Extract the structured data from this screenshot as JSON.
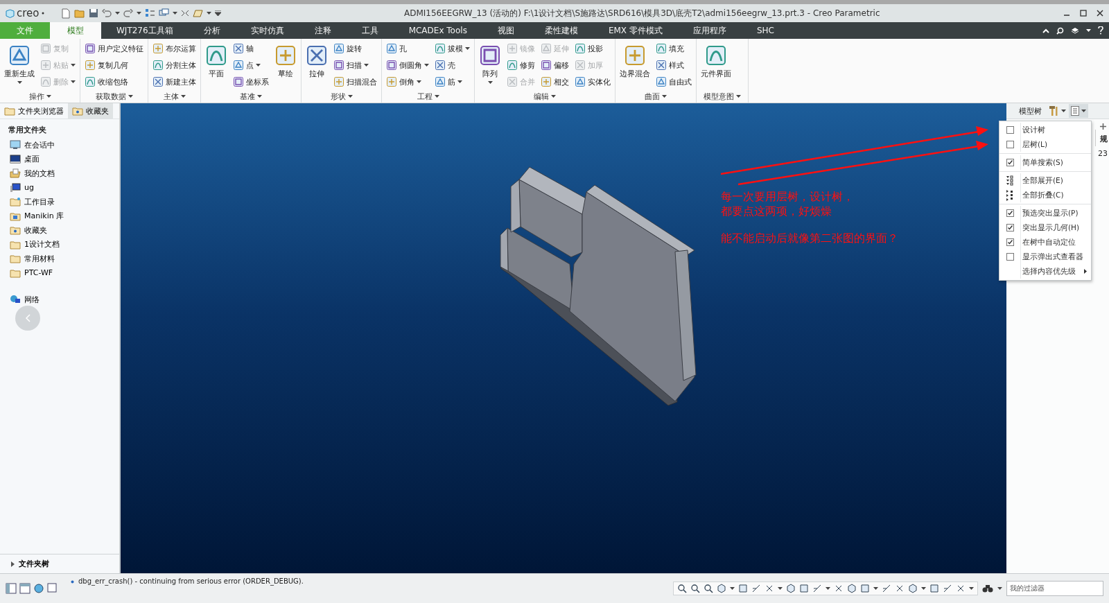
{
  "window": {
    "logo": "creo",
    "title": "ADMI156EEGRW_13 (活动的) F:\\1设计文档\\S施路达\\SRD616\\模具3D\\底壳T2\\admi156eegrw_13.prt.3 - Creo Parametric"
  },
  "tabs": [
    {
      "label": "文件",
      "kind": "file",
      "selected": false
    },
    {
      "label": "模型",
      "kind": "tab",
      "selected": true
    },
    {
      "label": "WJT276工具箱",
      "kind": "tab",
      "selected": false
    },
    {
      "label": "分析",
      "kind": "tab",
      "selected": false
    },
    {
      "label": "实时仿真",
      "kind": "tab",
      "selected": false
    },
    {
      "label": "注释",
      "kind": "tab",
      "selected": false
    },
    {
      "label": "工具",
      "kind": "tab",
      "selected": false
    },
    {
      "label": "MCADEx Tools",
      "kind": "tab",
      "selected": false
    },
    {
      "label": "视图",
      "kind": "tab",
      "selected": false
    },
    {
      "label": "柔性建模",
      "kind": "tab",
      "selected": false
    },
    {
      "label": "EMX 零件模式",
      "kind": "tab",
      "selected": false
    },
    {
      "label": "应用程序",
      "kind": "tab",
      "selected": false
    },
    {
      "label": "SHC",
      "kind": "tab",
      "selected": false
    }
  ],
  "ribbon": [
    {
      "label": "操作",
      "items": [
        {
          "kind": "large",
          "label": "重新生成",
          "menu": true,
          "disabled": false
        },
        {
          "kind": "small",
          "label": "复制",
          "menu": false,
          "disabled": true
        },
        {
          "kind": "small",
          "label": "粘贴",
          "menu": true,
          "disabled": true
        },
        {
          "kind": "small",
          "label": "删除",
          "menu": true,
          "disabled": true
        }
      ]
    },
    {
      "label": "获取数据",
      "items": [
        {
          "kind": "small",
          "label": "用户定义特征",
          "menu": false,
          "disabled": false
        },
        {
          "kind": "small",
          "label": "复制几何",
          "menu": false,
          "disabled": false
        },
        {
          "kind": "small",
          "label": "收缩包络",
          "menu": false,
          "disabled": false
        }
      ]
    },
    {
      "label": "主体",
      "items": [
        {
          "kind": "small",
          "label": "布尔运算",
          "menu": false,
          "disabled": false
        },
        {
          "kind": "small",
          "label": "分割主体",
          "menu": false,
          "disabled": false
        },
        {
          "kind": "small",
          "label": "新建主体",
          "menu": false,
          "disabled": false
        }
      ]
    },
    {
      "label": "基准",
      "items": [
        {
          "kind": "large",
          "label": "平面",
          "menu": false,
          "disabled": false
        },
        {
          "kind": "small",
          "label": "轴",
          "menu": false,
          "disabled": false
        },
        {
          "kind": "small",
          "label": "点",
          "menu": true,
          "disabled": false
        },
        {
          "kind": "small",
          "label": "坐标系",
          "menu": false,
          "disabled": false
        },
        {
          "kind": "large",
          "label": "草绘",
          "menu": false,
          "disabled": false
        }
      ]
    },
    {
      "label": "形状",
      "items": [
        {
          "kind": "large",
          "label": "拉伸",
          "menu": false,
          "disabled": false
        },
        {
          "kind": "small",
          "label": "旋转",
          "menu": false,
          "disabled": false
        },
        {
          "kind": "small",
          "label": "扫描",
          "menu": true,
          "disabled": false
        },
        {
          "kind": "small",
          "label": "扫描混合",
          "menu": false,
          "disabled": false
        }
      ]
    },
    {
      "label": "工程",
      "items": [
        {
          "kind": "small",
          "label": "孔",
          "menu": false,
          "disabled": false
        },
        {
          "kind": "small",
          "label": "倒圆角",
          "menu": true,
          "disabled": false
        },
        {
          "kind": "small",
          "label": "倒角",
          "menu": true,
          "disabled": false
        },
        {
          "kind": "small",
          "label": "拔模",
          "menu": true,
          "disabled": false
        },
        {
          "kind": "small",
          "label": "壳",
          "menu": false,
          "disabled": false
        },
        {
          "kind": "small",
          "label": "筋",
          "menu": true,
          "disabled": false
        }
      ]
    },
    {
      "label": "编辑",
      "items": [
        {
          "kind": "large",
          "label": "阵列",
          "menu": true,
          "disabled": false
        },
        {
          "kind": "small",
          "label": "镜像",
          "menu": false,
          "disabled": true
        },
        {
          "kind": "small",
          "label": "修剪",
          "menu": false,
          "disabled": false
        },
        {
          "kind": "small",
          "label": "合并",
          "menu": false,
          "disabled": true
        },
        {
          "kind": "small",
          "label": "延伸",
          "menu": false,
          "disabled": true
        },
        {
          "kind": "small",
          "label": "偏移",
          "menu": false,
          "disabled": false
        },
        {
          "kind": "small",
          "label": "相交",
          "menu": false,
          "disabled": false
        },
        {
          "kind": "small",
          "label": "投影",
          "menu": false,
          "disabled": false
        },
        {
          "kind": "small",
          "label": "加厚",
          "menu": false,
          "disabled": true
        },
        {
          "kind": "small",
          "label": "实体化",
          "menu": false,
          "disabled": false
        }
      ]
    },
    {
      "label": "曲面",
      "items": [
        {
          "kind": "large",
          "label": "边界混合",
          "menu": false,
          "disabled": false
        },
        {
          "kind": "small",
          "label": "填充",
          "menu": false,
          "disabled": false
        },
        {
          "kind": "small",
          "label": "样式",
          "menu": false,
          "disabled": false
        },
        {
          "kind": "small",
          "label": "自由式",
          "menu": false,
          "disabled": false
        }
      ]
    },
    {
      "label": "模型意图",
      "items": [
        {
          "kind": "large",
          "label": "元件界面",
          "menu": false,
          "disabled": false
        }
      ]
    }
  ],
  "folder_browser": {
    "tabs": [
      {
        "label": "文件夹浏览器",
        "selected": true
      },
      {
        "label": "收藏夹",
        "selected": false
      }
    ],
    "heading": "常用文件夹",
    "items": [
      {
        "label": "在会话中",
        "kind": "monitor"
      },
      {
        "label": "桌面",
        "kind": "desktop"
      },
      {
        "label": "我的文档",
        "kind": "documents"
      },
      {
        "label": "ug",
        "kind": "computer"
      },
      {
        "label": "工作目录",
        "kind": "workdir"
      },
      {
        "label": "Manikin 库",
        "kind": "library"
      },
      {
        "label": "收藏夹",
        "kind": "favorites"
      },
      {
        "label": "1设计文档",
        "kind": "folder"
      },
      {
        "label": "常用材料",
        "kind": "folder"
      },
      {
        "label": "PTC-WF",
        "kind": "folder"
      }
    ],
    "network": "网络",
    "footer": "文件夹树"
  },
  "viewport": {
    "notes": [
      "每一次要用层树，设计树，",
      "都要点这两项，好烦燥",
      "能不能启动后就像第二张图的界面？"
    ]
  },
  "model_tree": {
    "title": "模型树",
    "column_3": "规",
    "cell": "23",
    "menu": [
      [
        {
          "kind": "check",
          "label": "设计树",
          "checked": false
        },
        {
          "kind": "check",
          "label": "层树(L)",
          "checked": false
        }
      ],
      [
        {
          "kind": "check",
          "label": "简单搜索(S)",
          "checked": true
        }
      ],
      [
        {
          "kind": "expand",
          "label": "全部展开(E)"
        },
        {
          "kind": "collapse",
          "label": "全部折叠(C)"
        }
      ],
      [
        {
          "kind": "check",
          "label": "预选突出显示(P)",
          "checked": true
        },
        {
          "kind": "check",
          "label": "突出显示几何(H)",
          "checked": true
        },
        {
          "kind": "check",
          "label": "在树中自动定位",
          "checked": true
        },
        {
          "kind": "check",
          "label": "显示弹出式查看器",
          "checked": false
        },
        {
          "kind": "submenu",
          "label": "选择内容优先级"
        }
      ]
    ]
  },
  "status_bar": {
    "message": "dbg_err_crash() - continuing from serious error (ORDER_DEBUG).",
    "filter": "我的过滤器"
  }
}
